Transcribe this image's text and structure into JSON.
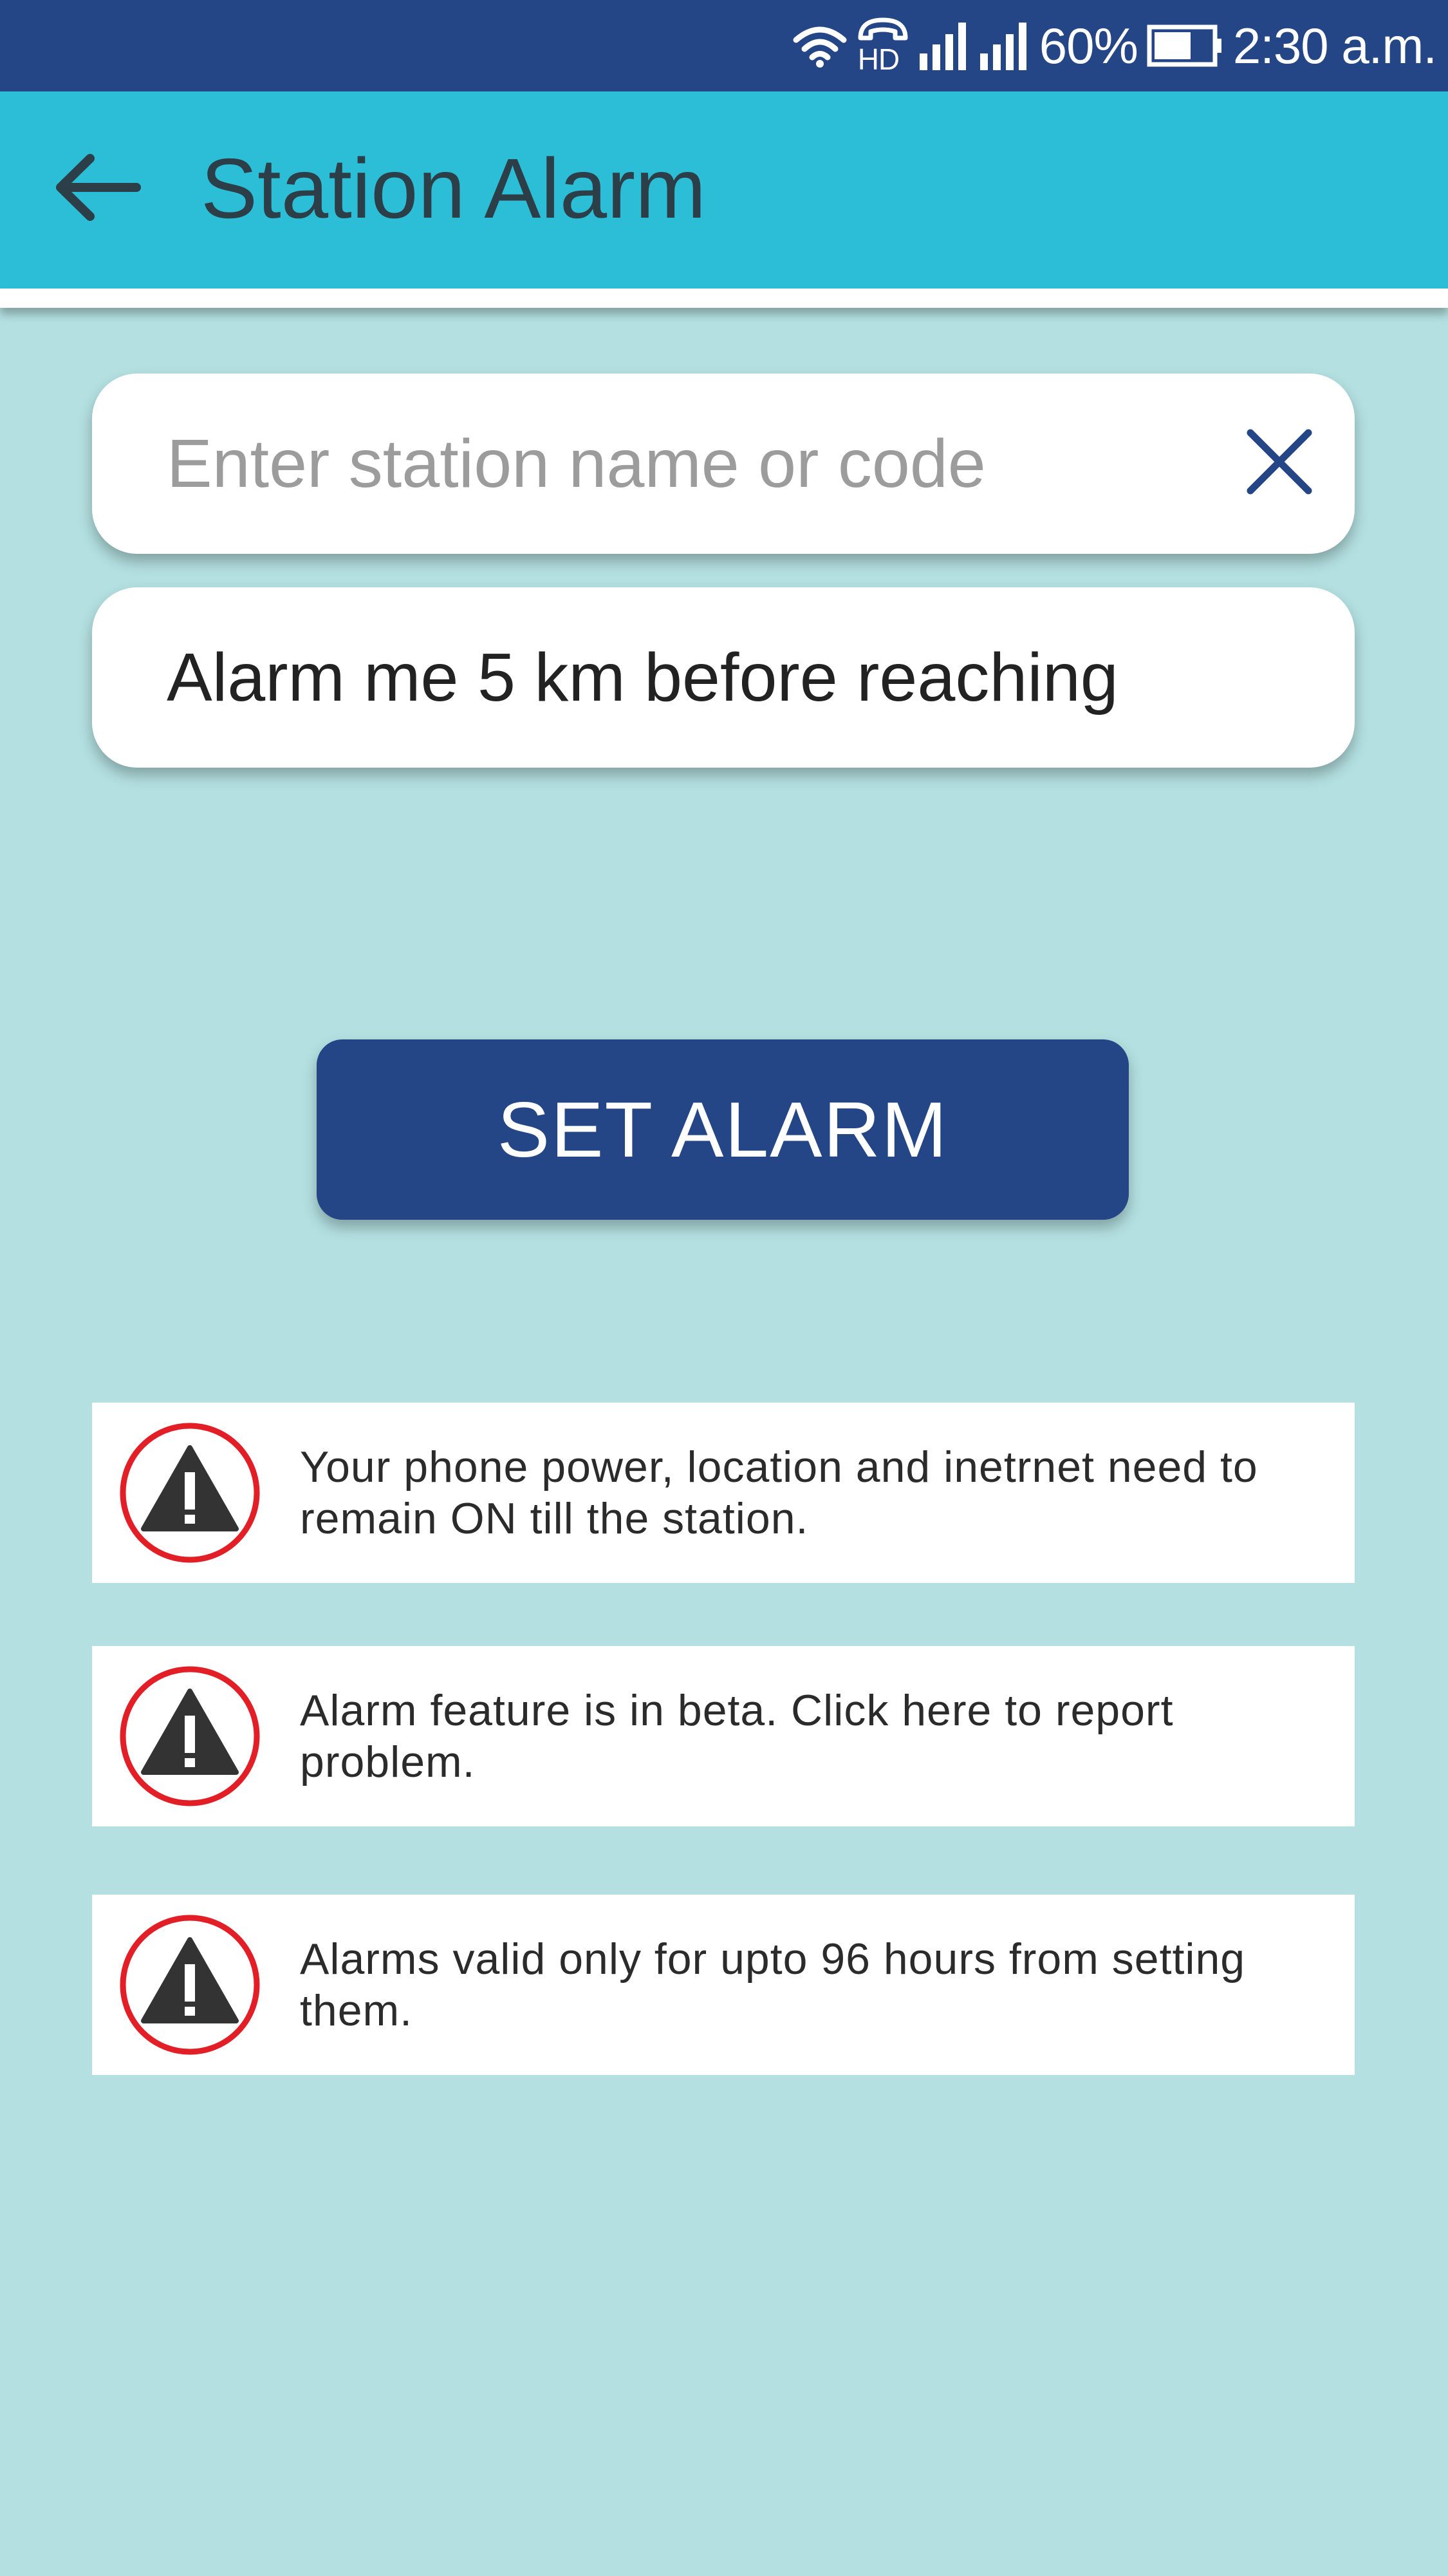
{
  "status_bar": {
    "network_label": "HD",
    "battery_percent": "60%",
    "time": "2:30 a.m."
  },
  "app_bar": {
    "back_icon": "arrow-left-icon",
    "title": "Station Alarm"
  },
  "search": {
    "placeholder": "Enter station name or code",
    "value": "",
    "clear_icon": "close-icon"
  },
  "distance_option": {
    "label": "Alarm me 5 km before reaching"
  },
  "set_alarm_button": {
    "label": "SET ALARM"
  },
  "notices": [
    {
      "icon": "warning-icon",
      "text": "Your phone power, location and inetrnet need to remain ON till the station."
    },
    {
      "icon": "warning-icon",
      "text": "Alarm feature is in beta. Click here to report problem."
    },
    {
      "icon": "warning-icon",
      "text": "Alarms valid only for upto 96 hours from setting them."
    }
  ],
  "colors": {
    "status_bar": "#244586",
    "app_bar": "#2bbed6",
    "background": "#b4e0e1",
    "primary_button": "#244586",
    "warning_ring": "#e21f26"
  }
}
